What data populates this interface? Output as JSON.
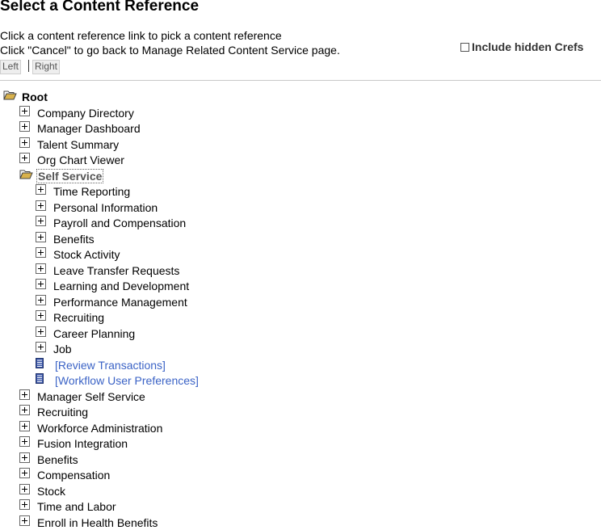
{
  "page": {
    "title": "Select a Content Reference",
    "instruction_1": "Click a content reference link to pick a content reference",
    "instruction_2": "Click \"Cancel\" to go back to Manage Related Content Service page.",
    "include_hidden_label": "Include hidden Crefs",
    "include_hidden_checked": false,
    "left_label": "Left",
    "right_label": "Right"
  },
  "tree": {
    "root": "Root",
    "level1_before": [
      "Company Directory",
      "Manager Dashboard",
      "Talent Summary",
      "Org Chart Viewer"
    ],
    "open_folder": "Self Service",
    "children": [
      "Time Reporting",
      "Personal Information",
      "Payroll and Compensation",
      "Benefits",
      "Stock Activity",
      "Leave Transfer Requests",
      "Learning and Development",
      "Performance Management",
      "Recruiting",
      "Career Planning",
      "Job"
    ],
    "child_links": [
      "[Review Transactions]",
      "[Workflow User Preferences]"
    ],
    "level1_after": [
      "Manager Self Service",
      "Recruiting",
      "Workforce Administration",
      "Fusion Integration",
      "Benefits",
      "Compensation",
      "Stock",
      "Time and Labor",
      "Enroll in Health Benefits"
    ]
  },
  "colors": {
    "link": "#3b63c6",
    "current_node": "#555555",
    "folder": "#d9b24c"
  }
}
